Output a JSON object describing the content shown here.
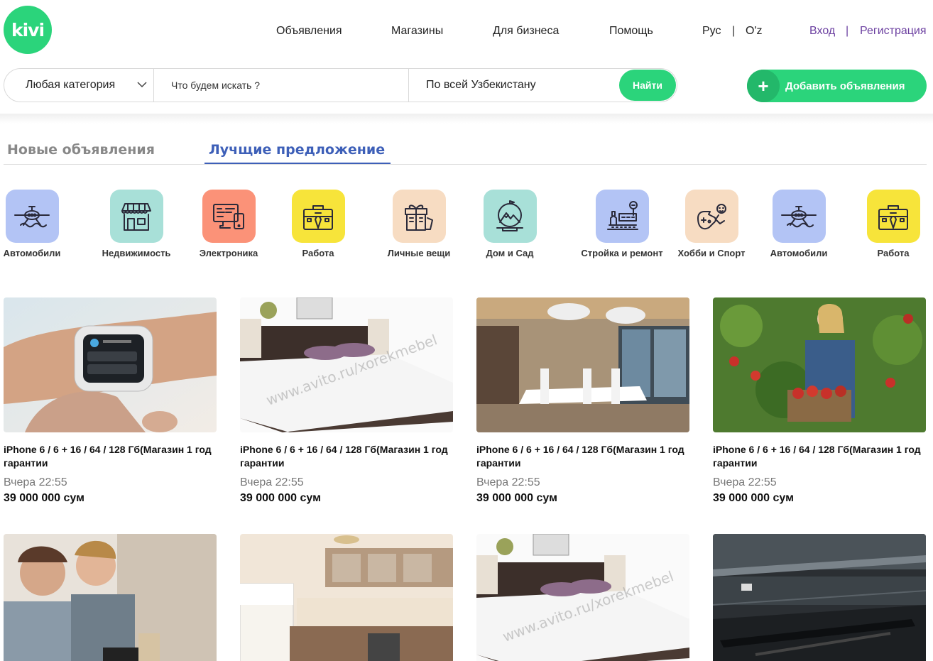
{
  "header": {
    "logo": "kivi",
    "nav": [
      "Объявления",
      "Магазины",
      "Для бизнеса",
      "Помощь"
    ],
    "lang": {
      "ru": "Рус",
      "separator": "|",
      "uz": "O'z"
    },
    "auth": {
      "login": "Вход",
      "separator": "|",
      "register": "Регистрация"
    }
  },
  "search": {
    "category": "Любая категория",
    "placeholder": "Что будем искать ?",
    "region": "По всей Узбекистану",
    "button": "Найти"
  },
  "add_button": {
    "icon": "+",
    "label": "Добавить объявления"
  },
  "tabs": [
    {
      "label": "Новые объявления",
      "active": false
    },
    {
      "label": "Лучщие предложение",
      "active": true
    }
  ],
  "categories": [
    {
      "label": "Автомобили",
      "icon": "airplane-icon",
      "color": "#b3c4f5"
    },
    {
      "label": "Недвижимость",
      "icon": "store-icon",
      "color": "#a8e0d8"
    },
    {
      "label": "Электроника",
      "icon": "computer-icon",
      "color": "#fb9278"
    },
    {
      "label": "Работа",
      "icon": "briefcase-icon",
      "color": "#f7e43a"
    },
    {
      "label": "Личные вещи",
      "icon": "gift-icon",
      "color": "#f7dcc2"
    },
    {
      "label": "Дом и Сад",
      "icon": "mountain-icon",
      "color": "#a8e0d8"
    },
    {
      "label": "Стройка и ремонт",
      "icon": "factory-icon",
      "color": "#b3c4f5"
    },
    {
      "label": "Хобби и Спорт",
      "icon": "gamepad-icon",
      "color": "#f7dcc2"
    },
    {
      "label": "Автомобили",
      "icon": "airplane-icon",
      "color": "#b3c4f5"
    },
    {
      "label": "Работа",
      "icon": "briefcase-icon",
      "color": "#f7e43a"
    }
  ],
  "listings": [
    {
      "title": "iPhone 6 / 6 + 16 / 64 / 128 Гб(Магазин 1 год гарантии",
      "time": "Вчера 22:55",
      "price": "39 000 000 сум",
      "image": "smartwatch-photo"
    },
    {
      "title": "iPhone 6 / 6 + 16 / 64 / 128 Гб(Магазин 1 год гарантии",
      "time": "Вчера 22:55",
      "price": "39 000 000 сум",
      "image": "bed-photo"
    },
    {
      "title": "iPhone 6 / 6 + 16 / 64 / 128 Гб(Магазин 1 год гарантии",
      "time": "Вчера 22:55",
      "price": "39 000 000 сум",
      "image": "dining-room-photo"
    },
    {
      "title": "iPhone 6 / 6 + 16 / 64 / 128 Гб(Магазин 1 год гарантии",
      "time": "Вчера 22:55",
      "price": "39 000 000 сум",
      "image": "apple-picking-photo"
    },
    {
      "image": "people-laptop-photo"
    },
    {
      "image": "kitchen-photo"
    },
    {
      "image": "bed-photo"
    },
    {
      "image": "warehouse-photo"
    }
  ],
  "watermark": "www.avito.ru/xorekmebel"
}
